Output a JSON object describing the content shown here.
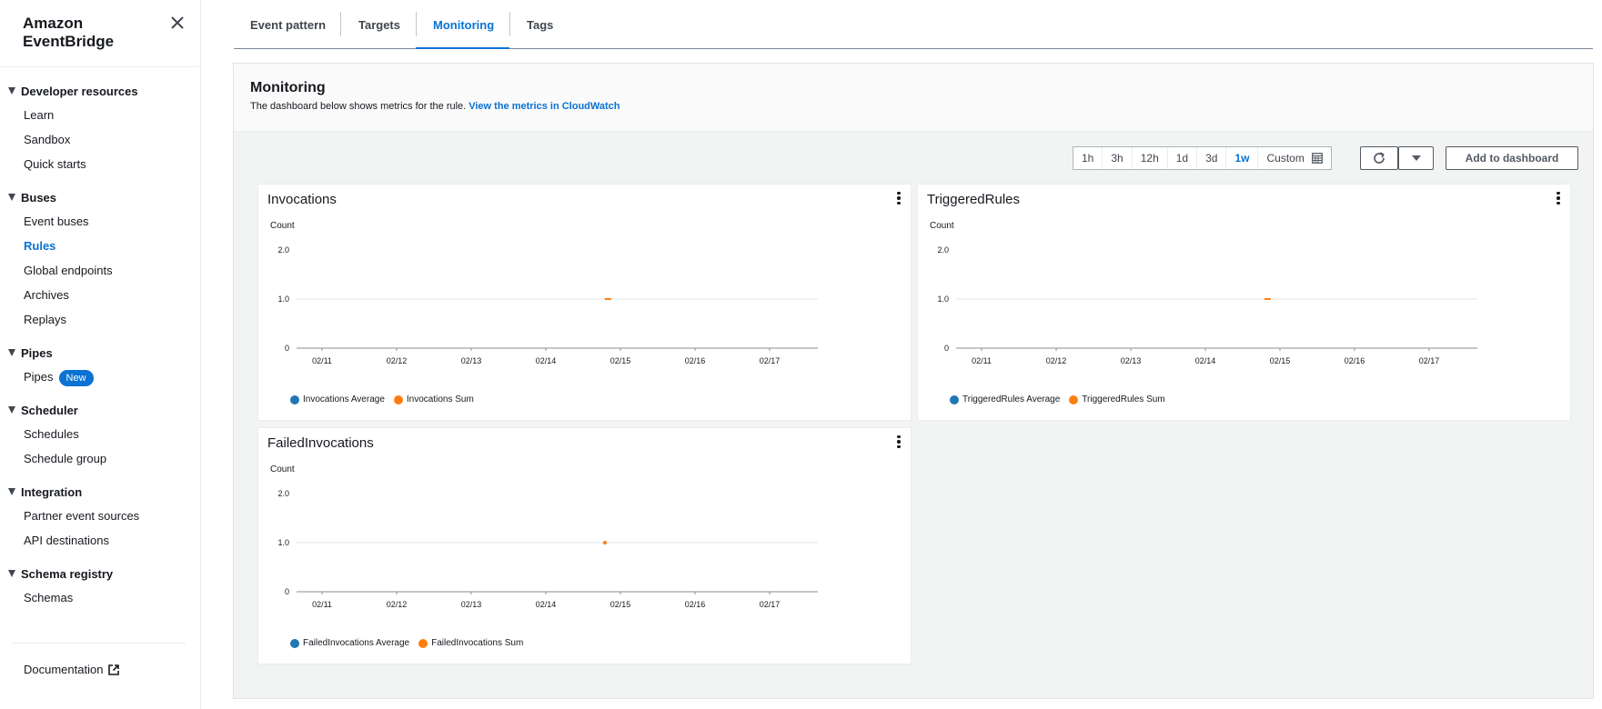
{
  "sidebar": {
    "brand": "Amazon EventBridge",
    "sections": [
      {
        "title": "Developer resources",
        "items": [
          {
            "label": "Learn"
          },
          {
            "label": "Sandbox"
          },
          {
            "label": "Quick starts"
          }
        ]
      },
      {
        "title": "Buses",
        "items": [
          {
            "label": "Event buses"
          },
          {
            "label": "Rules",
            "active": true
          },
          {
            "label": "Global endpoints"
          },
          {
            "label": "Archives"
          },
          {
            "label": "Replays"
          }
        ]
      },
      {
        "title": "Pipes",
        "items": [
          {
            "label": "Pipes",
            "badge": "New"
          }
        ]
      },
      {
        "title": "Scheduler",
        "items": [
          {
            "label": "Schedules"
          },
          {
            "label": "Schedule group"
          }
        ]
      },
      {
        "title": "Integration",
        "items": [
          {
            "label": "Partner event sources"
          },
          {
            "label": "API destinations"
          }
        ]
      },
      {
        "title": "Schema registry",
        "items": [
          {
            "label": "Schemas"
          }
        ]
      }
    ],
    "documentation": "Documentation"
  },
  "tabs": [
    {
      "label": "Event pattern"
    },
    {
      "label": "Targets"
    },
    {
      "label": "Monitoring",
      "active": true
    },
    {
      "label": "Tags"
    }
  ],
  "monitoring": {
    "title": "Monitoring",
    "description": "The dashboard below shows metrics for the rule.",
    "link": "View the metrics in CloudWatch",
    "ranges": [
      "1h",
      "3h",
      "12h",
      "1d",
      "3d",
      "1w",
      "Custom"
    ],
    "selected_range": "1w",
    "add_to_dashboard": "Add to dashboard"
  },
  "colors": {
    "average": "#1f78b4",
    "sum": "#ff7f0e",
    "accent": "#0972d3"
  },
  "chart_data": [
    {
      "type": "line",
      "title": "Invocations",
      "ylabel": "Count",
      "ylim": [
        0,
        2
      ],
      "yticks": [
        "0",
        "1.0",
        "2.0"
      ],
      "x": [
        "02/11",
        "02/12",
        "02/13",
        "02/14",
        "02/15",
        "02/16",
        "02/17"
      ],
      "series": [
        {
          "name": "Invocations Average",
          "points": []
        },
        {
          "name": "Invocations Sum",
          "points": [
            {
              "x": "02/14 19:00",
              "y": 1
            },
            {
              "x": "02/14 21:00",
              "y": 1
            }
          ]
        }
      ]
    },
    {
      "type": "line",
      "title": "TriggeredRules",
      "ylabel": "Count",
      "ylim": [
        0,
        2
      ],
      "yticks": [
        "0",
        "1.0",
        "2.0"
      ],
      "x": [
        "02/11",
        "02/12",
        "02/13",
        "02/14",
        "02/15",
        "02/16",
        "02/17"
      ],
      "series": [
        {
          "name": "TriggeredRules Average",
          "points": []
        },
        {
          "name": "TriggeredRules Sum",
          "points": [
            {
              "x": "02/14 19:00",
              "y": 1
            },
            {
              "x": "02/14 21:00",
              "y": 1
            }
          ]
        }
      ]
    },
    {
      "type": "line",
      "title": "FailedInvocations",
      "ylabel": "Count",
      "ylim": [
        0,
        2
      ],
      "yticks": [
        "0",
        "1.0",
        "2.0"
      ],
      "x": [
        "02/11",
        "02/12",
        "02/13",
        "02/14",
        "02/15",
        "02/16",
        "02/17"
      ],
      "series": [
        {
          "name": "FailedInvocations Average",
          "points": []
        },
        {
          "name": "FailedInvocations Sum",
          "points": [
            {
              "x": "02/14 19:00",
              "y": 1
            }
          ]
        }
      ]
    }
  ]
}
